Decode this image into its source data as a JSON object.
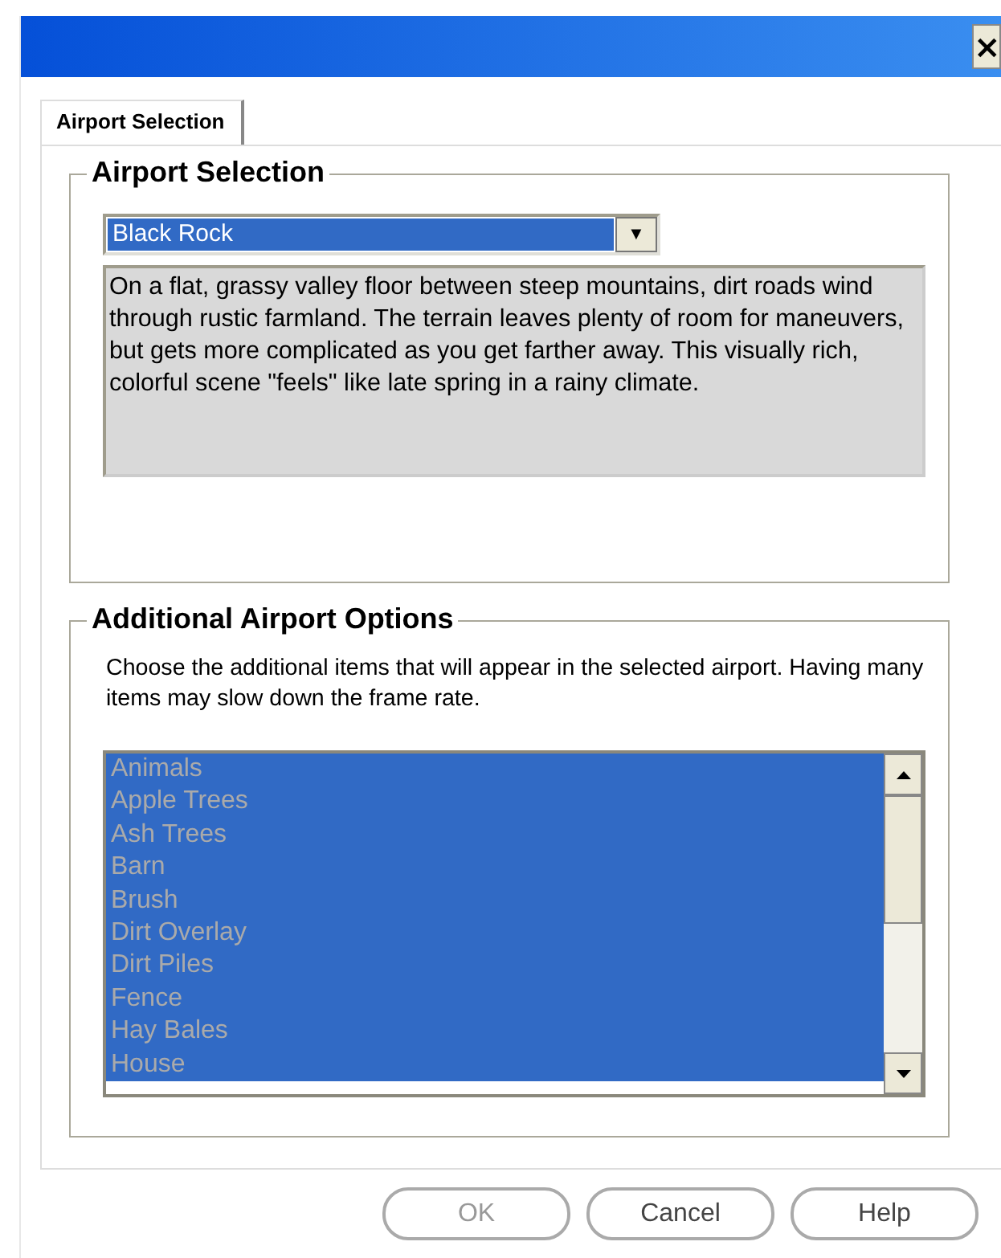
{
  "window": {
    "close": "×"
  },
  "tabs": [
    {
      "label": "Airport Selection",
      "selected": true
    }
  ],
  "airport_selection": {
    "title": "Airport Selection",
    "dropdown": {
      "value": "Black Rock",
      "arrow": "▼"
    },
    "description": "On a flat, grassy valley floor between steep mountains, dirt roads wind through rustic farmland. The terrain leaves plenty of room for maneuvers, but gets more complicated as you get farther away. This visually rich, colorful scene \"feels\" like late spring in a rainy climate."
  },
  "additional_options": {
    "title": "Additional Airport Options",
    "instructions": "Choose the additional items that will appear in the selected airport. Having many items may slow down the frame rate.",
    "items": [
      {
        "label": "Animals",
        "selected": true
      },
      {
        "label": "Apple Trees",
        "selected": true
      },
      {
        "label": "Ash Trees",
        "selected": true
      },
      {
        "label": "Barn",
        "selected": true
      },
      {
        "label": "Brush",
        "selected": true
      },
      {
        "label": "Dirt Overlay",
        "selected": true
      },
      {
        "label": "Dirt Piles",
        "selected": true
      },
      {
        "label": "Fence",
        "selected": true
      },
      {
        "label": "Hay Bales",
        "selected": true
      },
      {
        "label": "House",
        "selected": true
      }
    ]
  },
  "buttons": [
    {
      "label": "OK",
      "disabled": true
    },
    {
      "label": "Cancel",
      "disabled": false
    },
    {
      "label": "Help",
      "disabled": false
    }
  ]
}
